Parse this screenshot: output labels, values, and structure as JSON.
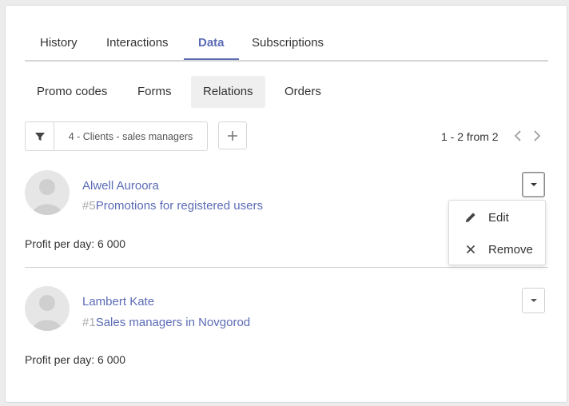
{
  "main_tabs": [
    {
      "label": "History"
    },
    {
      "label": "Interactions"
    },
    {
      "label": "Data"
    },
    {
      "label": "Subscriptions"
    }
  ],
  "active_main_tab": "Data",
  "sub_tabs": [
    {
      "label": "Promo codes"
    },
    {
      "label": "Forms"
    },
    {
      "label": "Relations"
    },
    {
      "label": "Orders"
    }
  ],
  "active_sub_tab": "Relations",
  "filter": {
    "value": "4 - Clients - sales managers",
    "icon": "filter-icon"
  },
  "add_button": {
    "icon": "plus-icon"
  },
  "pager": {
    "text": "1 - 2 from 2",
    "prev_icon": "chevron-left-icon",
    "next_icon": "chevron-right-icon"
  },
  "items": [
    {
      "name": "Alwell Auroora",
      "rel_number": "#5",
      "rel_title": "Promotions for registered users",
      "profit": "Profit per day: 6 000"
    },
    {
      "name": "Lambert Kate",
      "rel_number": "#1",
      "rel_title": "Sales managers in Novgorod",
      "profit": "Profit per day: 6 000"
    }
  ],
  "dropdown_menu": {
    "edit_label": "Edit",
    "edit_icon": "pencil-icon",
    "remove_label": "Remove",
    "remove_icon": "close-icon"
  },
  "colors": {
    "accent": "#5b6bb5",
    "muted_number": "#a9a9a9"
  }
}
